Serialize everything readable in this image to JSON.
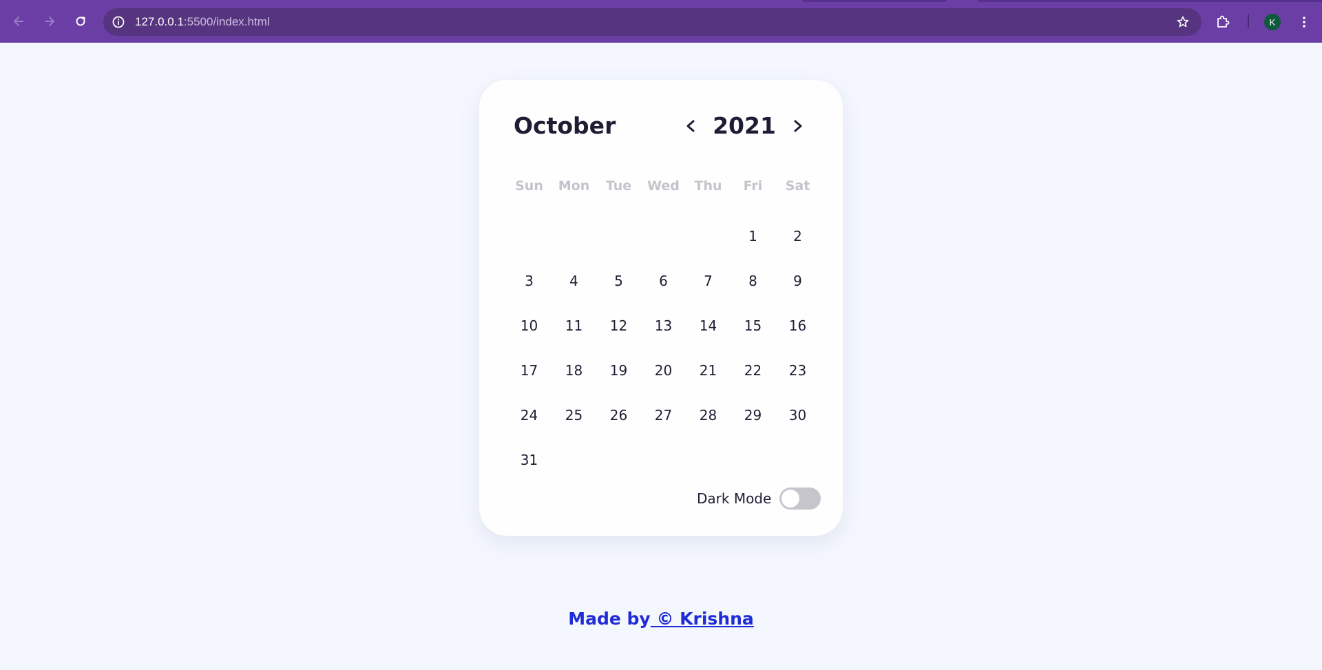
{
  "browser": {
    "url_host": "127.0.0.1",
    "url_path": ":5500/index.html",
    "profile_initial": "K",
    "icons": {
      "back": "arrow-left-icon",
      "forward": "arrow-right-icon",
      "reload": "reload-icon",
      "site_info": "info-icon",
      "bookmark": "star-icon",
      "extensions": "puzzle-icon",
      "menu": "kebab-menu-icon"
    }
  },
  "calendar": {
    "month": "October",
    "year": "2021",
    "weekdays": [
      "Sun",
      "Mon",
      "Tue",
      "Wed",
      "Thu",
      "Fri",
      "Sat"
    ],
    "leading_blanks": 5,
    "days": [
      "1",
      "2",
      "3",
      "4",
      "5",
      "6",
      "7",
      "8",
      "9",
      "10",
      "11",
      "12",
      "13",
      "14",
      "15",
      "16",
      "17",
      "18",
      "19",
      "20",
      "21",
      "22",
      "23",
      "24",
      "25",
      "26",
      "27",
      "28",
      "29",
      "30",
      "31"
    ],
    "prev_icon": "chevron-left-icon",
    "next_icon": "chevron-right-icon",
    "dark_mode_label": "Dark Mode",
    "dark_mode_on": false
  },
  "footer": {
    "prefix": "Made by",
    "link_text": " © Krishna"
  },
  "colors": {
    "browser_frame": "#6a3ea5",
    "omnibox": "#56347f",
    "page_bg": "#f4f7fd",
    "card_bg": "#fefefe",
    "text": "#1f1d33",
    "weekday_text": "#c4c4cc",
    "footer_link": "#1f2bd6",
    "toggle_off": "#c5c5cb"
  }
}
